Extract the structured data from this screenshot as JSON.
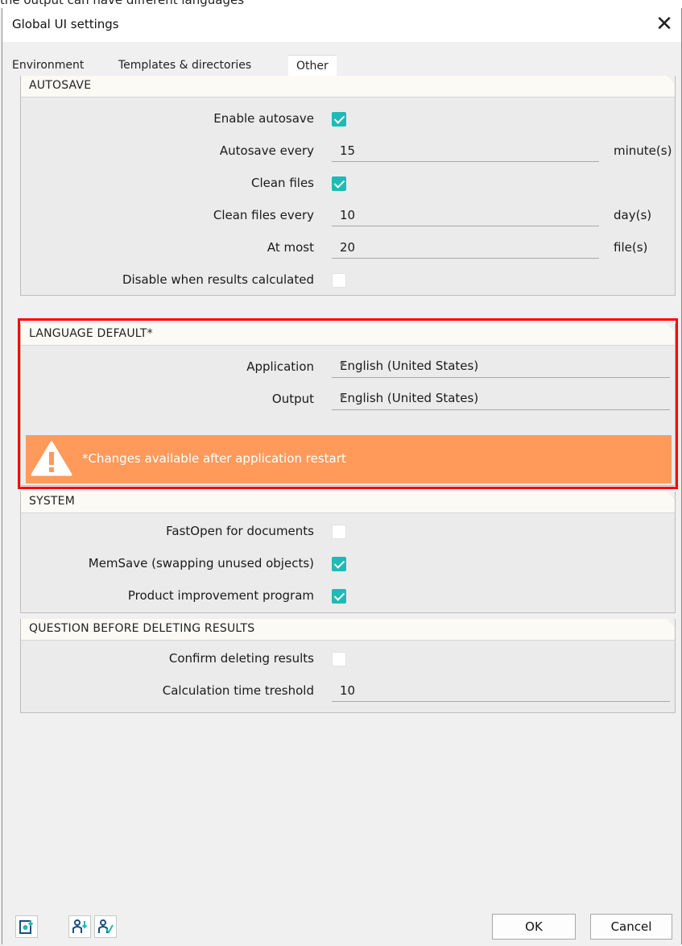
{
  "top_strip_text": "the output can have different languages",
  "window": {
    "title": "Global UI settings"
  },
  "tabs": [
    {
      "label": "Environment",
      "active": false
    },
    {
      "label": "Templates & directories",
      "active": false
    },
    {
      "label": "Other",
      "active": true
    }
  ],
  "autosave": {
    "header": "AUTOSAVE",
    "enable_label": "Enable autosave",
    "enable_checked": true,
    "every_label": "Autosave every",
    "every_value": "15",
    "every_unit": "minute(s)",
    "clean_label": "Clean files",
    "clean_checked": true,
    "clean_every_label": "Clean files every",
    "clean_every_value": "10",
    "clean_every_unit": "day(s)",
    "at_most_label": "At most",
    "at_most_value": "20",
    "at_most_unit": "file(s)",
    "disable_label": "Disable when results calculated",
    "disable_checked": false
  },
  "language": {
    "header": "LANGUAGE DEFAULT*",
    "application_label": "Application",
    "application_value": "English (United States)",
    "output_label": "Output",
    "output_value": "English (United States)",
    "warning_text": "*Changes available after application restart"
  },
  "system": {
    "header": "SYSTEM",
    "fastopen_label": "FastOpen for documents",
    "fastopen_checked": false,
    "memsave_label": "MemSave (swapping unused objects)",
    "memsave_checked": true,
    "product_label": "Product improvement program",
    "product_checked": true
  },
  "question": {
    "header": "QUESTION BEFORE DELETING RESULTS",
    "confirm_label": "Confirm deleting results",
    "confirm_checked": false,
    "threshold_label": "Calculation time treshold",
    "threshold_value": "10"
  },
  "footer": {
    "ok_label": "OK",
    "cancel_label": "Cancel"
  },
  "colors": {
    "accent_check": "#1fbab5",
    "warning_bg": "#ff9a5b",
    "highlight_border": "#ff0000"
  }
}
